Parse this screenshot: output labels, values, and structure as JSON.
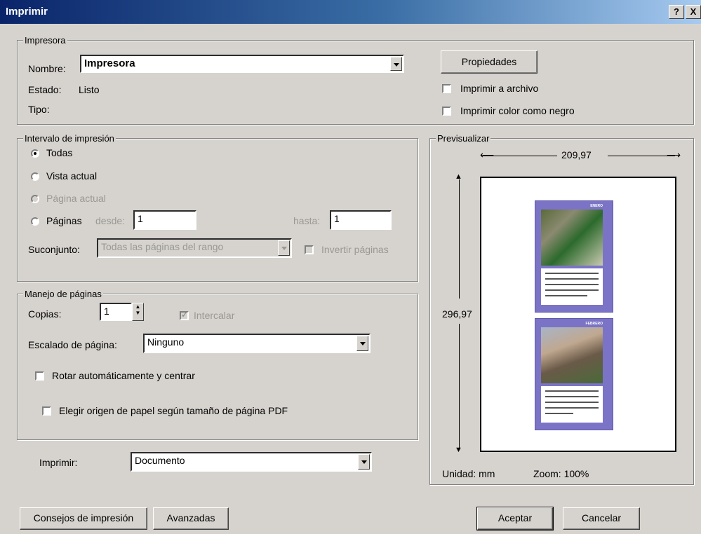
{
  "window": {
    "title": "Imprimir",
    "help_label": "?",
    "close_label": "X"
  },
  "printer": {
    "legend": "Impresora",
    "name_label": "Nombre:",
    "name_value": "Impresora",
    "status_label": "Estado:",
    "status_value": "Listo",
    "type_label": "Tipo:",
    "properties_button": "Propiedades",
    "print_to_file": "Imprimir a archivo",
    "print_color_black": "Imprimir color como negro"
  },
  "range": {
    "legend": "Intervalo de impresión",
    "all": "Todas",
    "current_view": "Vista actual",
    "current_page": "Página actual",
    "pages": "Páginas",
    "from_label": "desde:",
    "from_value": "1",
    "to_label": "hasta:",
    "to_value": "1",
    "subset_label": "Suconjunto:",
    "subset_value": "Todas las páginas del rango",
    "reverse_pages": "Invertir páginas"
  },
  "handling": {
    "legend": "Manejo de páginas",
    "copies_label": "Copias:",
    "copies_value": "1",
    "collate": "Intercalar",
    "scaling_label": "Escalado de página:",
    "scaling_value": "Ninguno",
    "auto_rotate": "Rotar automáticamente y centrar",
    "paper_source": "Elegir origen de papel según tamaño de página PDF"
  },
  "print_what": {
    "label": "Imprimir:",
    "value": "Documento"
  },
  "preview": {
    "legend": "Previsualizar",
    "width": "209,97",
    "height": "296,97",
    "unit": "Unidad: mm",
    "zoom": "Zoom: 100%",
    "months": [
      "ENERO",
      "FEBRERO"
    ]
  },
  "footer": {
    "tips_button": "Consejos de impresión",
    "advanced_button": "Avanzadas",
    "ok_button": "Aceptar",
    "cancel_button": "Cancelar"
  },
  "colors": {
    "titlebar": "#0a246a",
    "dialog_bg": "#d6d3ce",
    "calendar": "#7b74c6"
  }
}
